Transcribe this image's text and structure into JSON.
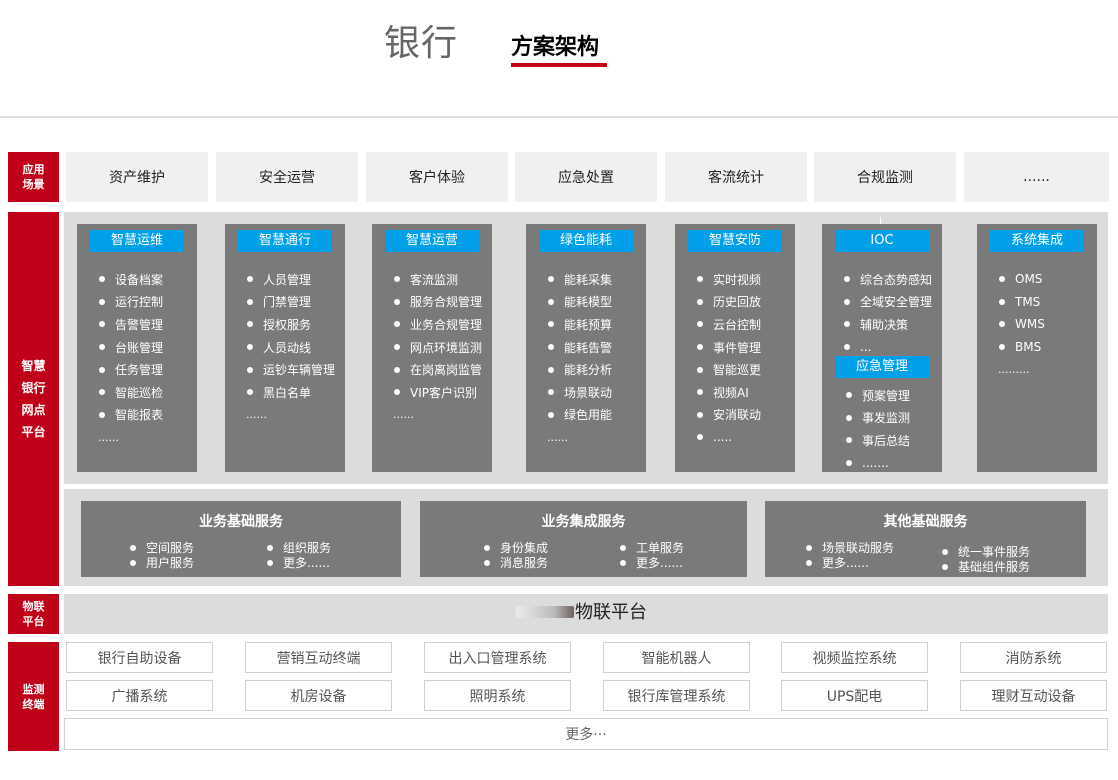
{
  "header": {
    "title": "银行",
    "subtitle": "方案架构"
  },
  "sidebar": {
    "scene": "应用\n场景",
    "platform": "智慧\n银行\n网点\n平台",
    "iot": "物联\n平台",
    "terminal": "监测\n终端"
  },
  "scenes": [
    "资产维护",
    "安全运营",
    "客户体验",
    "应急处置",
    "客流统计",
    "合规监测",
    "......"
  ],
  "modules": [
    {
      "title": "智慧运维",
      "items": [
        "设备档案",
        "运行控制",
        "告警管理",
        "台账管理",
        "任务管理",
        "智能巡检",
        "智能报表"
      ],
      "more": "......"
    },
    {
      "title": "智慧通行",
      "items": [
        "人员管理",
        "门禁管理",
        "授权服务",
        "人员动线",
        "运钞车辆管理",
        "黑白名单"
      ],
      "more": "......"
    },
    {
      "title": "智慧运营",
      "items": [
        "客流监测",
        "服务合规管理",
        "业务合规管理",
        "网点环境监测",
        "在岗离岗监管",
        "VIP客户识别"
      ],
      "more": "......"
    },
    {
      "title": "绿色能耗",
      "items": [
        "能耗采集",
        "能耗模型",
        "能耗预算",
        "能耗告警",
        "能耗分析",
        "场景联动",
        "绿色用能"
      ],
      "more": "......"
    },
    {
      "title": "智慧安防",
      "items": [
        "实时视频",
        "历史回放",
        "云台控制",
        "事件管理",
        "智能巡更",
        "视频AI",
        "安消联动",
        "....."
      ]
    },
    {
      "title": "IOC",
      "items": [
        "综合态势感知",
        "全域安全管理",
        "辅助决策",
        "..."
      ],
      "sub_title": "应急管理",
      "sub_items": [
        "预案管理",
        "事发监测",
        "事后总结",
        "......."
      ]
    },
    {
      "title": "系统集成",
      "items": [
        "OMS",
        "TMS",
        "WMS",
        "BMS"
      ],
      "more": "........."
    }
  ],
  "services": [
    {
      "title": "业务基础服务",
      "col1": [
        "空间服务",
        "用户服务"
      ],
      "col2": [
        "组织服务",
        "更多......"
      ]
    },
    {
      "title": "业务集成服务",
      "col1": [
        "身份集成",
        "消息服务"
      ],
      "col2": [
        "工单服务",
        "更多......"
      ]
    },
    {
      "title": "其他基础服务",
      "col1": [
        "场景联动服务",
        "更多......"
      ],
      "col2": [
        "统一事件服务",
        "基础组件服务"
      ]
    }
  ],
  "iot_platform": "物联平台",
  "devices": [
    [
      "银行自助设备",
      "营销互动终端",
      "出入口管理系统",
      "智能机器人",
      "视频监控系统",
      "消防系统"
    ],
    [
      "广播系统",
      "机房设备",
      "照明系统",
      "银行库管理系统",
      "UPS配电",
      "理财互动设备"
    ]
  ],
  "more_devices": "更多···"
}
